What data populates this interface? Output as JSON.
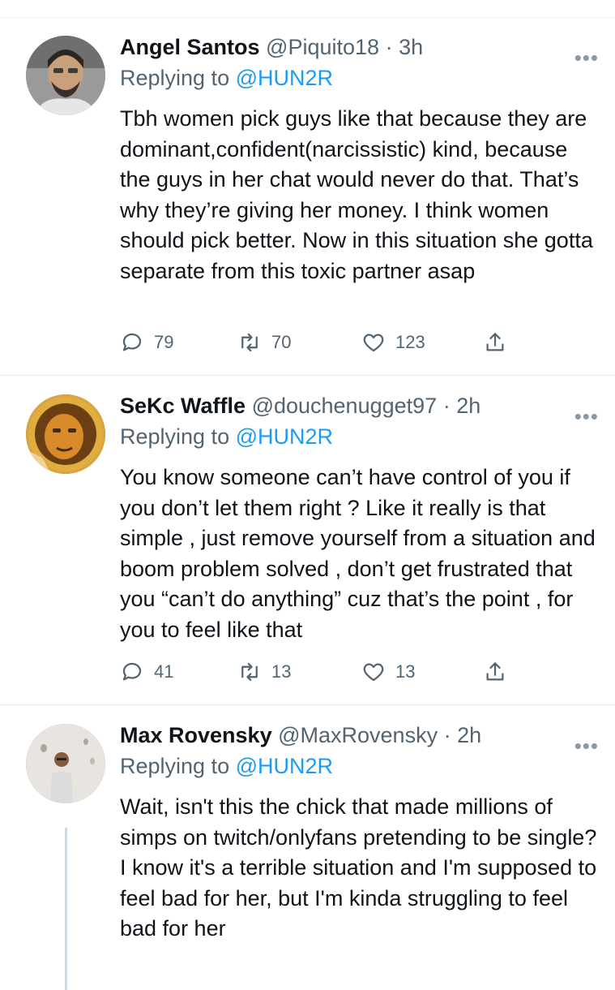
{
  "tweets": [
    {
      "name": "Angel Santos",
      "handle": "@Piquito18",
      "time": "3h",
      "replying_prefix": "Replying to",
      "replying_to": "@HUN2R",
      "text": "Tbh women pick guys like that because they are dominant,confident(narcissistic) kind, because the guys in her chat would never do that. That’s why they’re giving her money. I think women should pick better. Now in this situation she gotta separate from this toxic partner asap",
      "replies": "79",
      "retweets": "70",
      "likes": "123"
    },
    {
      "name": "SeKc Waffle",
      "handle": "@douchenugget97",
      "time": "2h",
      "replying_prefix": "Replying to",
      "replying_to": "@HUN2R",
      "text": "You know someone can’t have control of you if you don’t let them right ? Like it really is that simple , just remove yourself from a situation and boom problem solved , don’t get frustrated that you “can’t do anything” cuz that’s the point , for you to feel like that",
      "replies": "41",
      "retweets": "13",
      "likes": "13"
    },
    {
      "name": "Max Rovensky",
      "handle": "@MaxRovensky",
      "time": "2h",
      "replying_prefix": "Replying to",
      "replying_to": "@HUN2R",
      "text": "Wait, isn't this the chick that made millions of simps on twitch/onlyfans pretending to be single?\nI know it's a terrible situation and I'm supposed to feel bad for her, but I'm kinda struggling to feel bad for her"
    }
  ],
  "separator": "·",
  "more_glyph": "•••",
  "icons": {
    "reply": "reply-icon",
    "retweet": "retweet-icon",
    "like": "heart-icon",
    "share": "share-icon",
    "more": "more-icon"
  },
  "colors": {
    "text": "#0f1419",
    "secondary": "#536471",
    "accent": "#1d9bf0",
    "divider": "#e6ecf0"
  }
}
